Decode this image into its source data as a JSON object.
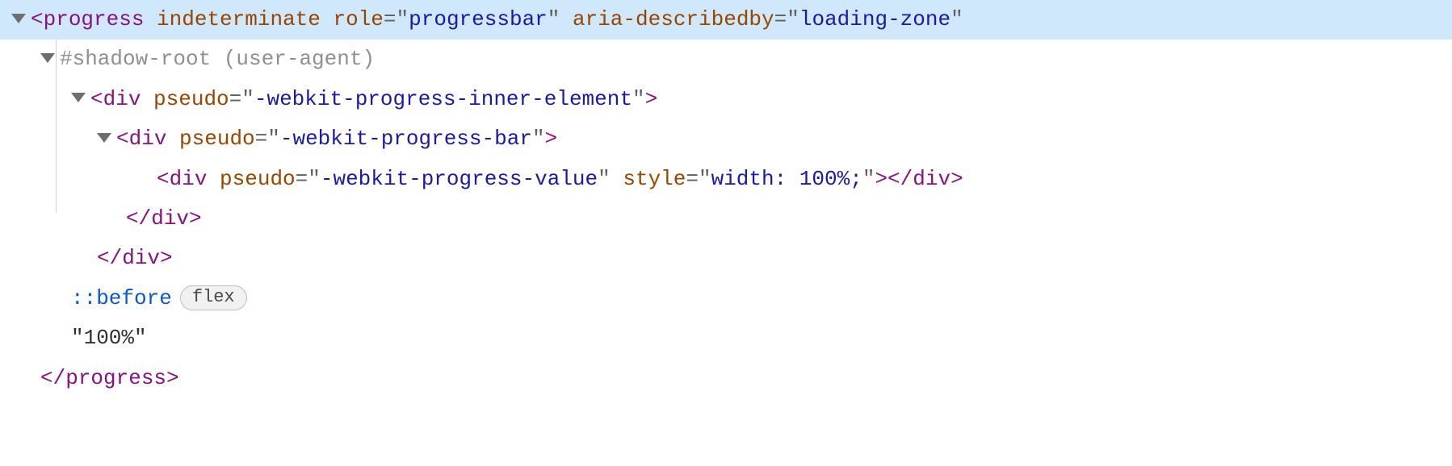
{
  "line1": {
    "tag": "progress",
    "attr1_name": "indeterminate",
    "attr2_name": "role",
    "attr2_val": "progressbar",
    "attr3_name": "aria-describedby",
    "attr3_val": "loading-zone"
  },
  "line2": {
    "text": "#shadow-root (user-agent)"
  },
  "line3": {
    "tag": "div",
    "attr_name": "pseudo",
    "attr_val": "-webkit-progress-inner-element"
  },
  "line4": {
    "tag": "div",
    "attr_name": "pseudo",
    "attr_val": "-webkit-progress-bar"
  },
  "line5": {
    "tag": "div",
    "attr1_name": "pseudo",
    "attr1_val": "-webkit-progress-value",
    "attr2_name": "style",
    "attr2_val": "width: 100%;",
    "close": "div"
  },
  "line6": {
    "close": "div"
  },
  "line7": {
    "close": "div"
  },
  "line8": {
    "pseudo": "::before",
    "badge": "flex"
  },
  "line9": {
    "text": "\"100%\""
  },
  "line10": {
    "close": "progress"
  }
}
